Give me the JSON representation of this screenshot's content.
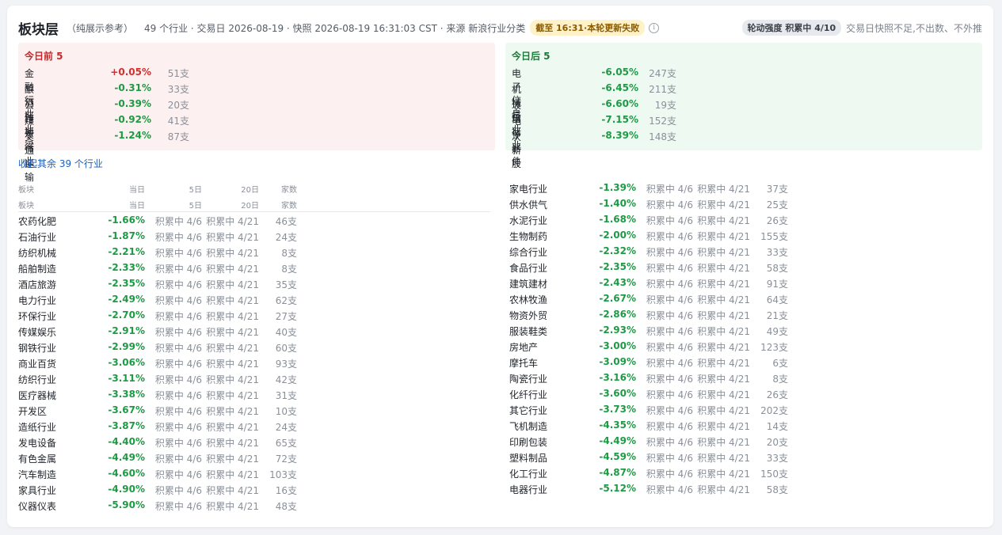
{
  "header": {
    "title": "板块层",
    "subtitle": "（纯展示参考）",
    "meta": "49 个行业 · 交易日 2026-08-19 · 快照 2026-08-19 16:31:03 CST · 来源 新浪行业分类",
    "warn_badge": "截至 16:31·本轮更新失败",
    "info_icon": "i",
    "strength_badge": "轮动强度 积累中 4/10",
    "strength_note": "交易日快照不足,不出数、不外推"
  },
  "colors": {
    "up": "#d32f2f",
    "down": "#1e9a45",
    "up_bg": "#fdf0f0",
    "down_bg": "#eefaf1"
  },
  "top5": {
    "title": "今日前 5",
    "rows": [
      {
        "name": "金融行业",
        "pct": "+0.05%",
        "count": "51支",
        "dir": "pos"
      },
      {
        "name": "酿酒行业",
        "pct": "-0.31%",
        "count": "33支",
        "dir": "neg"
      },
      {
        "name": "公路桥梁",
        "pct": "-0.39%",
        "count": "20支",
        "dir": "neg"
      },
      {
        "name": "煤炭行业",
        "pct": "-0.92%",
        "count": "41支",
        "dir": "neg"
      },
      {
        "name": "交通运输",
        "pct": "-1.24%",
        "count": "87支",
        "dir": "neg"
      }
    ]
  },
  "bottom5": {
    "title": "今日后 5",
    "rows": [
      {
        "name": "电子信息",
        "pct": "-6.05%",
        "count": "247支",
        "dir": "neg"
      },
      {
        "name": "机械行业",
        "pct": "-6.45%",
        "count": "211支",
        "dir": "neg"
      },
      {
        "name": "玻璃行业",
        "pct": "-6.60%",
        "count": "19支",
        "dir": "neg"
      },
      {
        "name": "电子器件",
        "pct": "-7.15%",
        "count": "152支",
        "dir": "neg"
      },
      {
        "name": "次新股",
        "pct": "-8.39%",
        "count": "148支",
        "dir": "neg"
      }
    ]
  },
  "collapse_link": "收起其余 39 个行业",
  "table_headers": {
    "name": "板块",
    "day": "当日",
    "d5": "5日",
    "d20": "20日",
    "count": "家数"
  },
  "left_rows": [
    {
      "name": "农药化肥",
      "pct": "-1.66%",
      "d5": "积累中 4/6",
      "d20": "积累中 4/21",
      "count": "46支"
    },
    {
      "name": "石油行业",
      "pct": "-1.87%",
      "d5": "积累中 4/6",
      "d20": "积累中 4/21",
      "count": "24支"
    },
    {
      "name": "纺织机械",
      "pct": "-2.21%",
      "d5": "积累中 4/6",
      "d20": "积累中 4/21",
      "count": "8支"
    },
    {
      "name": "船舶制造",
      "pct": "-2.33%",
      "d5": "积累中 4/6",
      "d20": "积累中 4/21",
      "count": "8支"
    },
    {
      "name": "酒店旅游",
      "pct": "-2.35%",
      "d5": "积累中 4/6",
      "d20": "积累中 4/21",
      "count": "35支"
    },
    {
      "name": "电力行业",
      "pct": "-2.49%",
      "d5": "积累中 4/6",
      "d20": "积累中 4/21",
      "count": "62支"
    },
    {
      "name": "环保行业",
      "pct": "-2.70%",
      "d5": "积累中 4/6",
      "d20": "积累中 4/21",
      "count": "27支"
    },
    {
      "name": "传媒娱乐",
      "pct": "-2.91%",
      "d5": "积累中 4/6",
      "d20": "积累中 4/21",
      "count": "40支"
    },
    {
      "name": "钢铁行业",
      "pct": "-2.99%",
      "d5": "积累中 4/6",
      "d20": "积累中 4/21",
      "count": "60支"
    },
    {
      "name": "商业百货",
      "pct": "-3.06%",
      "d5": "积累中 4/6",
      "d20": "积累中 4/21",
      "count": "93支"
    },
    {
      "name": "纺织行业",
      "pct": "-3.11%",
      "d5": "积累中 4/6",
      "d20": "积累中 4/21",
      "count": "42支"
    },
    {
      "name": "医疗器械",
      "pct": "-3.38%",
      "d5": "积累中 4/6",
      "d20": "积累中 4/21",
      "count": "31支"
    },
    {
      "name": "开发区",
      "pct": "-3.67%",
      "d5": "积累中 4/6",
      "d20": "积累中 4/21",
      "count": "10支"
    },
    {
      "name": "造纸行业",
      "pct": "-3.87%",
      "d5": "积累中 4/6",
      "d20": "积累中 4/21",
      "count": "24支"
    },
    {
      "name": "发电设备",
      "pct": "-4.40%",
      "d5": "积累中 4/6",
      "d20": "积累中 4/21",
      "count": "65支"
    },
    {
      "name": "有色金属",
      "pct": "-4.49%",
      "d5": "积累中 4/6",
      "d20": "积累中 4/21",
      "count": "72支"
    },
    {
      "name": "汽车制造",
      "pct": "-4.60%",
      "d5": "积累中 4/6",
      "d20": "积累中 4/21",
      "count": "103支"
    },
    {
      "name": "家具行业",
      "pct": "-4.90%",
      "d5": "积累中 4/6",
      "d20": "积累中 4/21",
      "count": "16支"
    },
    {
      "name": "仪器仪表",
      "pct": "-5.90%",
      "d5": "积累中 4/6",
      "d20": "积累中 4/21",
      "count": "48支"
    }
  ],
  "right_rows": [
    {
      "name": "家电行业",
      "pct": "-1.39%",
      "d5": "积累中 4/6",
      "d20": "积累中 4/21",
      "count": "37支"
    },
    {
      "name": "供水供气",
      "pct": "-1.40%",
      "d5": "积累中 4/6",
      "d20": "积累中 4/21",
      "count": "25支"
    },
    {
      "name": "水泥行业",
      "pct": "-1.68%",
      "d5": "积累中 4/6",
      "d20": "积累中 4/21",
      "count": "26支"
    },
    {
      "name": "生物制药",
      "pct": "-2.00%",
      "d5": "积累中 4/6",
      "d20": "积累中 4/21",
      "count": "155支"
    },
    {
      "name": "综合行业",
      "pct": "-2.32%",
      "d5": "积累中 4/6",
      "d20": "积累中 4/21",
      "count": "33支"
    },
    {
      "name": "食品行业",
      "pct": "-2.35%",
      "d5": "积累中 4/6",
      "d20": "积累中 4/21",
      "count": "58支"
    },
    {
      "name": "建筑建材",
      "pct": "-2.43%",
      "d5": "积累中 4/6",
      "d20": "积累中 4/21",
      "count": "91支"
    },
    {
      "name": "农林牧渔",
      "pct": "-2.67%",
      "d5": "积累中 4/6",
      "d20": "积累中 4/21",
      "count": "64支"
    },
    {
      "name": "物资外贸",
      "pct": "-2.86%",
      "d5": "积累中 4/6",
      "d20": "积累中 4/21",
      "count": "21支"
    },
    {
      "name": "服装鞋类",
      "pct": "-2.93%",
      "d5": "积累中 4/6",
      "d20": "积累中 4/21",
      "count": "49支"
    },
    {
      "name": "房地产",
      "pct": "-3.00%",
      "d5": "积累中 4/6",
      "d20": "积累中 4/21",
      "count": "123支"
    },
    {
      "name": "摩托车",
      "pct": "-3.09%",
      "d5": "积累中 4/6",
      "d20": "积累中 4/21",
      "count": "6支"
    },
    {
      "name": "陶瓷行业",
      "pct": "-3.16%",
      "d5": "积累中 4/6",
      "d20": "积累中 4/21",
      "count": "8支"
    },
    {
      "name": "化纤行业",
      "pct": "-3.60%",
      "d5": "积累中 4/6",
      "d20": "积累中 4/21",
      "count": "26支"
    },
    {
      "name": "其它行业",
      "pct": "-3.73%",
      "d5": "积累中 4/6",
      "d20": "积累中 4/21",
      "count": "202支"
    },
    {
      "name": "飞机制造",
      "pct": "-4.35%",
      "d5": "积累中 4/6",
      "d20": "积累中 4/21",
      "count": "14支"
    },
    {
      "name": "印刷包装",
      "pct": "-4.49%",
      "d5": "积累中 4/6",
      "d20": "积累中 4/21",
      "count": "20支"
    },
    {
      "name": "塑料制品",
      "pct": "-4.59%",
      "d5": "积累中 4/6",
      "d20": "积累中 4/21",
      "count": "33支"
    },
    {
      "name": "化工行业",
      "pct": "-4.87%",
      "d5": "积累中 4/6",
      "d20": "积累中 4/21",
      "count": "150支"
    },
    {
      "name": "电器行业",
      "pct": "-5.12%",
      "d5": "积累中 4/6",
      "d20": "积累中 4/21",
      "count": "58支"
    }
  ]
}
